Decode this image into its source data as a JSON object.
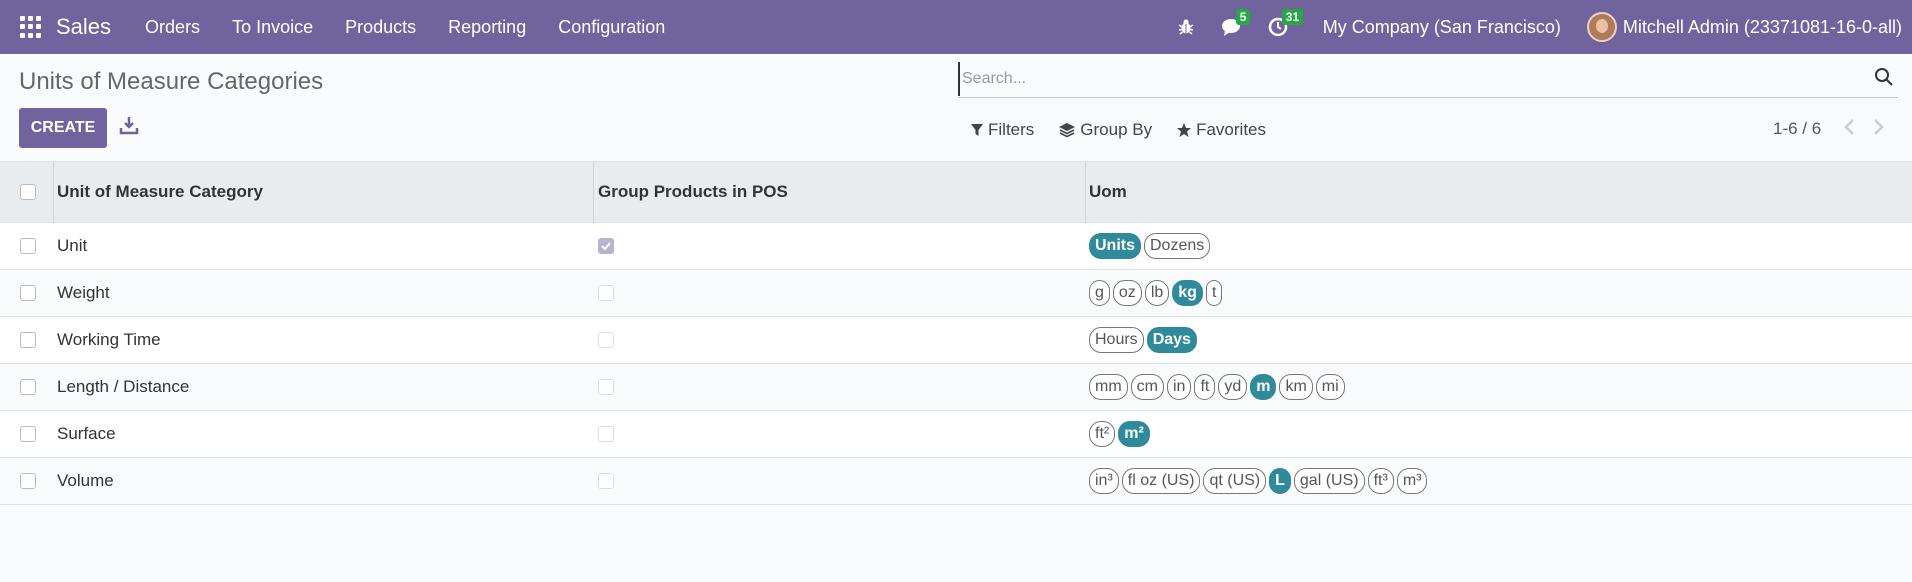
{
  "navbar": {
    "app_name": "Sales",
    "menu": [
      "Orders",
      "To Invoice",
      "Products",
      "Reporting",
      "Configuration"
    ],
    "messages_count": "5",
    "activities_count": "31",
    "company": "My Company (San Francisco)",
    "user": "Mitchell Admin (23371081-16-0-all)",
    "bar_color": "#71639e"
  },
  "page": {
    "title": "Units of Measure Categories",
    "create_label": "CREATE",
    "search_placeholder": "Search...",
    "filters_label": "Filters",
    "groupby_label": "Group By",
    "favorites_label": "Favorites",
    "pager": "1-6 / 6"
  },
  "table": {
    "headers": [
      "Unit of Measure Category",
      "Group Products in POS",
      "Uom"
    ],
    "rows": [
      {
        "name": "Unit",
        "pos": true,
        "uoms": [
          {
            "t": "Units",
            "ref": true
          },
          {
            "t": "Dozens",
            "ref": false
          }
        ]
      },
      {
        "name": "Weight",
        "pos": false,
        "uoms": [
          {
            "t": "g",
            "ref": false
          },
          {
            "t": "oz",
            "ref": false
          },
          {
            "t": "lb",
            "ref": false
          },
          {
            "t": "kg",
            "ref": true
          },
          {
            "t": "t",
            "ref": false
          }
        ]
      },
      {
        "name": "Working Time",
        "pos": false,
        "uoms": [
          {
            "t": "Hours",
            "ref": false
          },
          {
            "t": "Days",
            "ref": true
          }
        ]
      },
      {
        "name": "Length / Distance",
        "pos": false,
        "uoms": [
          {
            "t": "mm",
            "ref": false
          },
          {
            "t": "cm",
            "ref": false
          },
          {
            "t": "in",
            "ref": false
          },
          {
            "t": "ft",
            "ref": false
          },
          {
            "t": "yd",
            "ref": false
          },
          {
            "t": "m",
            "ref": true
          },
          {
            "t": "km",
            "ref": false
          },
          {
            "t": "mi",
            "ref": false
          }
        ]
      },
      {
        "name": "Surface",
        "pos": false,
        "uoms": [
          {
            "t": "ft²",
            "ref": false
          },
          {
            "t": "m²",
            "ref": true
          }
        ]
      },
      {
        "name": "Volume",
        "pos": false,
        "uoms": [
          {
            "t": "in³",
            "ref": false
          },
          {
            "t": "fl oz (US)",
            "ref": false
          },
          {
            "t": "qt (US)",
            "ref": false
          },
          {
            "t": "L",
            "ref": true
          },
          {
            "t": "gal (US)",
            "ref": false
          },
          {
            "t": "ft³",
            "ref": false
          },
          {
            "t": "m³",
            "ref": false
          }
        ]
      }
    ]
  },
  "colors": {
    "primary": "#71639e",
    "ref_tag": "#2f8a9b",
    "badge": "#28a745"
  }
}
